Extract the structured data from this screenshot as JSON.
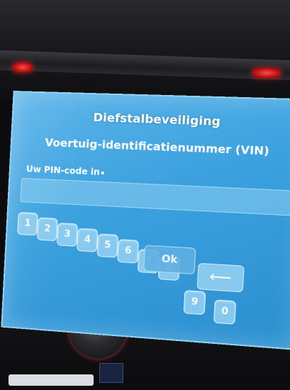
{
  "screen": {
    "title": "Diefstalbeveiliging",
    "subtitle": "Voertuig-identificatienummer (VIN)",
    "pin_label": "Uw PIN-code in",
    "pin_value": ""
  },
  "keypad": {
    "keys": [
      "1",
      "2",
      "3",
      "4",
      "5",
      "6",
      "7",
      "8",
      "9",
      "0"
    ],
    "ok_label": "Ok",
    "back_label": "⟵"
  },
  "colors": {
    "screen_bg": "#3aa0de",
    "text": "#ffffff",
    "led_red": "#e02020"
  }
}
